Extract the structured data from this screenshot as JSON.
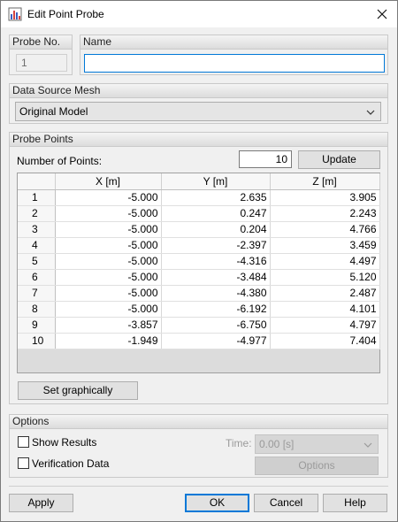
{
  "window": {
    "title": "Edit Point Probe"
  },
  "probe_no": {
    "label": "Probe No.",
    "value": "1"
  },
  "name": {
    "label": "Name",
    "value": ""
  },
  "data_source": {
    "label": "Data Source Mesh",
    "selected": "Original Model"
  },
  "probe_points": {
    "label": "Probe Points",
    "num_points_label": "Number of Points:",
    "num_points_value": "10",
    "update_label": "Update",
    "set_graphically_label": "Set graphically",
    "columns": [
      "",
      "X [m]",
      "Y [m]",
      "Z [m]"
    ],
    "rows": [
      [
        "1",
        "-5.000",
        "2.635",
        "3.905"
      ],
      [
        "2",
        "-5.000",
        "0.247",
        "2.243"
      ],
      [
        "3",
        "-5.000",
        "0.204",
        "4.766"
      ],
      [
        "4",
        "-5.000",
        "-2.397",
        "3.459"
      ],
      [
        "5",
        "-5.000",
        "-4.316",
        "4.497"
      ],
      [
        "6",
        "-5.000",
        "-3.484",
        "5.120"
      ],
      [
        "7",
        "-5.000",
        "-4.380",
        "2.487"
      ],
      [
        "8",
        "-5.000",
        "-6.192",
        "4.101"
      ],
      [
        "9",
        "-3.857",
        "-6.750",
        "4.797"
      ],
      [
        "10",
        "-1.949",
        "-4.977",
        "7.404"
      ]
    ]
  },
  "options": {
    "label": "Options",
    "show_results_label": "Show Results",
    "verification_label": "Verification Data",
    "time_label": "Time:",
    "time_value": "0.00 [s]",
    "options_button_label": "Options"
  },
  "footer": {
    "apply_label": "Apply",
    "ok_label": "OK",
    "cancel_label": "Cancel",
    "help_label": "Help"
  },
  "icons": {
    "app": "chart-app-icon",
    "close": "close-icon",
    "dropdown": "chevron-down-icon"
  },
  "colors": {
    "accent": "#0078d7",
    "app_icon": "#3b5fc0"
  }
}
